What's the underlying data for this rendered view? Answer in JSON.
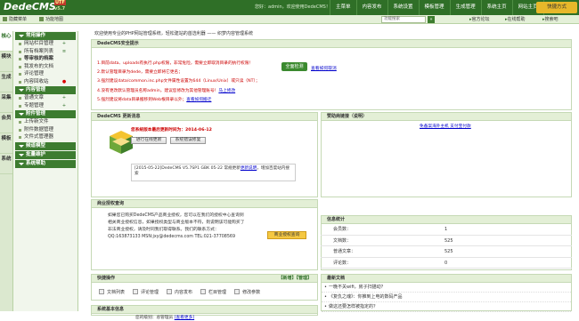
{
  "header": {
    "logo": "DedeCMS",
    "logo_badge": "UTF",
    "version": "v5.7",
    "welcome": "您好：admin，欢迎使用DedeCMS！",
    "nav": [
      "主菜单",
      "内容发布",
      "系统设置",
      "模板管理",
      "生成管理",
      "系统主页",
      "网站主页",
      "注销"
    ],
    "quick_menu": "快捷方式"
  },
  "toolbar": {
    "hide_menu": "隐藏菜单",
    "function_map": "功能地图",
    "search_placeholder": "功能搜索",
    "search_btn": "»",
    "forum": "官方论坛",
    "help": "在线帮助",
    "dede_bar": "搜索吧"
  },
  "sidebar_tabs": [
    "核心",
    "模块",
    "生成",
    "采集",
    "会员",
    "模板",
    "系统"
  ],
  "sidebar": {
    "groups": [
      {
        "title": "常用操作",
        "items": [
          {
            "label": "网站栏目管理",
            "bold": false,
            "icon": "add"
          },
          {
            "label": "所有档案列表",
            "bold": false,
            "icon": "list"
          },
          {
            "label": "等审核的档案",
            "bold": true,
            "icon": ""
          },
          {
            "label": "我发布的文档",
            "bold": false,
            "icon": ""
          },
          {
            "label": "评论管理",
            "bold": false,
            "icon": ""
          },
          {
            "label": "内容回收站",
            "bold": false,
            "icon": "alert"
          }
        ]
      },
      {
        "title": "内容管理",
        "items": [
          {
            "label": "普通文章",
            "bold": false,
            "icon": "add"
          },
          {
            "label": "专题管理",
            "bold": false,
            "icon": "add"
          }
        ]
      },
      {
        "title": "附件管理",
        "items": [
          {
            "label": "上传新文件",
            "bold": false,
            "icon": ""
          },
          {
            "label": "附件数据管理",
            "bold": false,
            "icon": ""
          },
          {
            "label": "文件式管理器",
            "bold": false,
            "icon": ""
          }
        ]
      },
      {
        "title": "频道模型",
        "items": []
      },
      {
        "title": "批量维护",
        "items": []
      },
      {
        "title": "系统帮助",
        "items": []
      }
    ]
  },
  "intro": "欢迎使用专业的PHP网站管理系统，轻松建站的首选利器 —— 织梦内容管理系统",
  "security": {
    "title": "DedeCMS安全提示",
    "lines": [
      {
        "num": "1.",
        "text": "目前data、uploads有执行.php权限，非常危险，需要立即取消目录的执行权限！",
        "link": ""
      },
      {
        "num": "2.",
        "text": "默认管理目录为dede，需要立即将它更名；",
        "link": ""
      },
      {
        "num": "3.",
        "text": "强烈建议data/common.inc.php文件属性设置为644（Linux/Unix）或只读（NT）；",
        "link": ""
      },
      {
        "num": "4.",
        "text": "没有更改默认管理员名称admin，建议您修改为其他管理账号！",
        "link": "马上修改"
      },
      {
        "num": "5.",
        "text": "强烈建议将data目录搬移到Web根目录以外；",
        "link": "查看如何搬迁"
      }
    ],
    "scan_button": "全面检测",
    "scan_link": "查看如何取消"
  },
  "update": {
    "title": "DedeCMS 更新消息",
    "latest": "您系统版本最后更新时间为：2014-06-12",
    "btn_enter": "进行在线更新",
    "btn_patch": "系统错误修复",
    "news": "[2015-05-22]DedeCMS V5.7SP1 GBK 05-22 常规更新",
    "news_link": "更新说明",
    "news_tail": "，增加百度站内搜索"
  },
  "sponsor": {
    "title": "赞助商链接（说明）",
    "link_text": "免备案海外主机 支付宝付款"
  },
  "auth": {
    "title": "商业授权查询",
    "text": "如果您已购买DedeCMS产品商业授权，您可以在我们的授权中心查询到相关商业授权信息，如果授权类型与商业版本不符，则说明该可能购买了非法商业授权，请及时同我们取得联系。我们的联系方式：QQ:163873133 MSN:jxy@dedecms.com TEL:021-37708569",
    "button": "商业授权查询"
  },
  "stats": {
    "title": "信息统计",
    "rows": [
      {
        "k": "会员数：",
        "v": "1"
      },
      {
        "k": "文档数：",
        "v": "525"
      },
      {
        "k": "普通文章：",
        "v": "525"
      },
      {
        "k": "评论数：",
        "v": "0"
      }
    ]
  },
  "quick": {
    "title": "快捷操作",
    "add": "【新增】",
    "manage": "【管理】",
    "items": [
      "文档列表",
      "评论管理",
      "内容发布",
      "栏目管理",
      "修改参数"
    ]
  },
  "latest": {
    "title": "最新文档",
    "items": [
      "一晚不关wifi，房子扫描动？",
      "《复仇之魂》：你推到上电的数码产品",
      "做这还要怎样被指定的？"
    ]
  },
  "sysinfo": {
    "title": "系统基本信息",
    "level_label": "您的级别：",
    "level_value": "总管理员",
    "view": "[查看更多]"
  }
}
